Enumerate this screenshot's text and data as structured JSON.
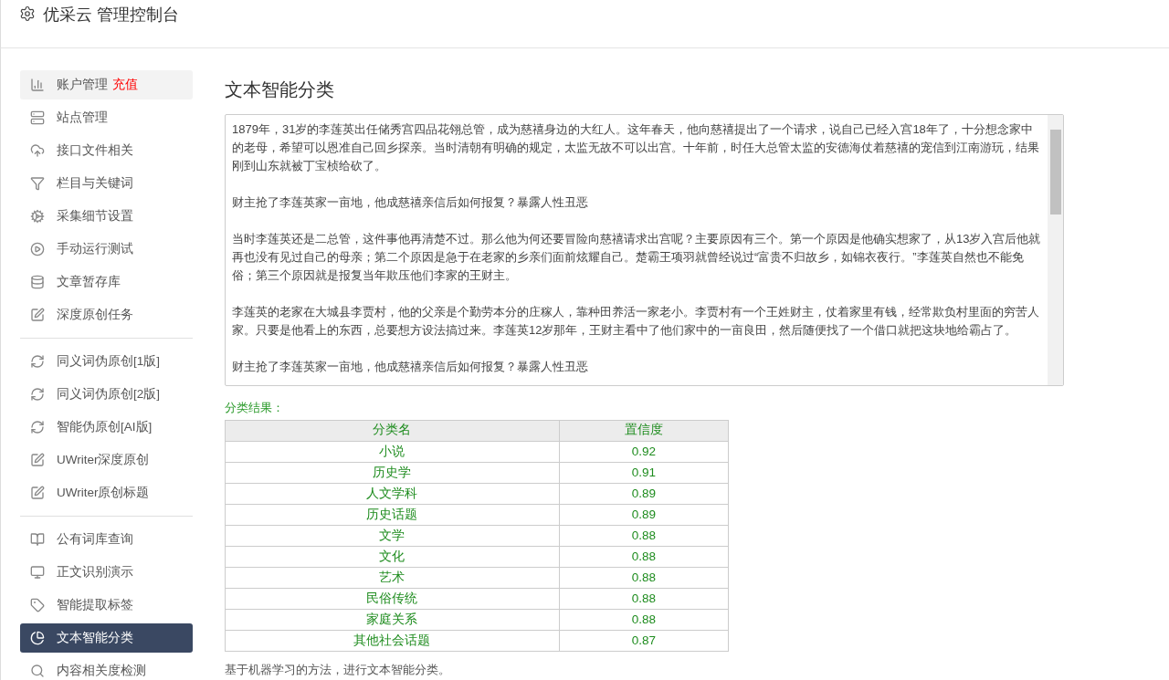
{
  "header": {
    "title": "优采云 管理控制台"
  },
  "sidebar": {
    "groups": [
      {
        "items": [
          {
            "label": "账户管理",
            "badge": "充值",
            "selected": false,
            "hovered": true
          },
          {
            "label": "站点管理",
            "selected": false,
            "hovered": false
          },
          {
            "label": "接口文件相关",
            "selected": false,
            "hovered": false
          },
          {
            "label": "栏目与关键词",
            "selected": false,
            "hovered": false
          },
          {
            "label": "采集细节设置",
            "selected": false,
            "hovered": false
          },
          {
            "label": "手动运行测试",
            "selected": false,
            "hovered": false
          },
          {
            "label": "文章暂存库",
            "selected": false,
            "hovered": false
          },
          {
            "label": "深度原创任务",
            "selected": false,
            "hovered": false
          }
        ]
      },
      {
        "items": [
          {
            "label": "同义词伪原创[1版]",
            "selected": false,
            "hovered": false
          },
          {
            "label": "同义词伪原创[2版]",
            "selected": false,
            "hovered": false
          },
          {
            "label": "智能伪原创[AI版]",
            "selected": false,
            "hovered": false
          },
          {
            "label": "UWriter深度原创",
            "selected": false,
            "hovered": false
          },
          {
            "label": "UWriter原创标题",
            "selected": false,
            "hovered": false
          }
        ]
      },
      {
        "items": [
          {
            "label": "公有词库查询",
            "selected": false,
            "hovered": false
          },
          {
            "label": "正文识别演示",
            "selected": false,
            "hovered": false
          },
          {
            "label": "智能提取标签",
            "selected": false,
            "hovered": false
          },
          {
            "label": "文本智能分类",
            "selected": true,
            "hovered": false
          },
          {
            "label": "内容相关度检测",
            "selected": false,
            "hovered": false
          }
        ]
      }
    ]
  },
  "main": {
    "title": "文本智能分类",
    "text_area": {
      "paragraphs": [
        "1879年，31岁的李莲英出任储秀宫四品花翎总管，成为慈禧身边的大红人。这年春天，他向慈禧提出了一个请求，说自己已经入宫18年了，十分想念家中的老母，希望可以恩准自己回乡探亲。当时清朝有明确的规定，太监无故不可以出宫。十年前，时任大总管太监的安德海仗着慈禧的宠信到江南游玩，结果刚到山东就被丁宝桢给砍了。",
        "财主抢了李莲英家一亩地，他成慈禧亲信后如何报复？暴露人性丑恶",
        "当时李莲英还是二总管，这件事他再清楚不过。那么他为何还要冒险向慈禧请求出宫呢？主要原因有三个。第一个原因是他确实想家了，从13岁入宫后他就再也没有见过自己的母亲；第二个原因是急于在老家的乡亲们面前炫耀自己。楚霸王项羽就曾经说过“富贵不归故乡，如锦衣夜行。”李莲英自然也不能免俗；第三个原因就是报复当年欺压他们李家的王财主。",
        "李莲英的老家在大城县李贾村，他的父亲是个勤劳本分的庄稼人，靠种田养活一家老小。李贾村有一个王姓财主，仗着家里有钱，经常欺负村里面的穷苦人家。只要是他看上的东西，总要想方设法搞过来。李莲英12岁那年，王财主看中了他们家中的一亩良田，然后随便找了一个借口就把这块地给霸占了。",
        "财主抢了李莲英家一亩地，他成慈禧亲信后如何报复？暴露人性丑恶"
      ]
    },
    "result_label": "分类结果：",
    "table": {
      "columns": [
        "分类名",
        "置信度"
      ],
      "rows": [
        [
          "小说",
          "0.92"
        ],
        [
          "历史学",
          "0.91"
        ],
        [
          "人文学科",
          "0.89"
        ],
        [
          "历史话题",
          "0.89"
        ],
        [
          "文学",
          "0.88"
        ],
        [
          "文化",
          "0.88"
        ],
        [
          "艺术",
          "0.88"
        ],
        [
          "民俗传统",
          "0.88"
        ],
        [
          "家庭关系",
          "0.88"
        ],
        [
          "其他社会话题",
          "0.87"
        ]
      ]
    },
    "footnote": "基于机器学习的方法，进行文本智能分类。"
  }
}
